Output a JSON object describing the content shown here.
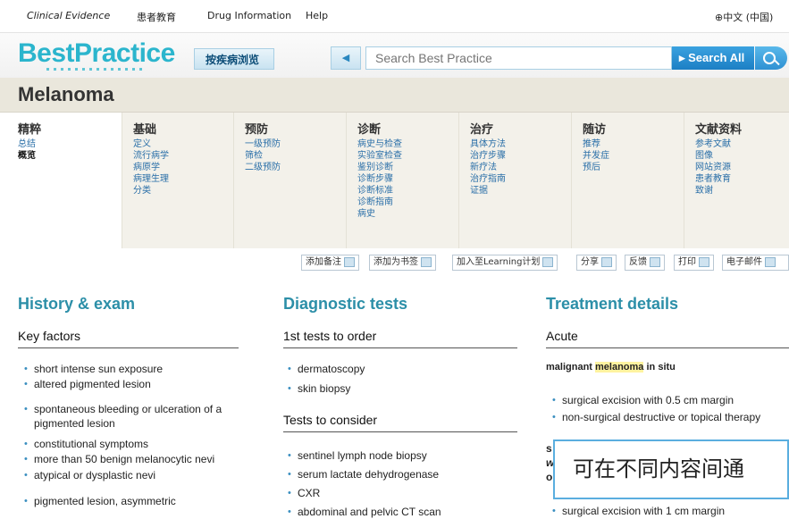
{
  "topnav": {
    "clinical_evidence": "Clinical Evidence",
    "patient_education": "患者教育",
    "drug_information": "Drug Information",
    "help": "Help",
    "language": "中文 (中国)"
  },
  "header": {
    "logo": "BestPractice",
    "browse_button": "按疾病浏览",
    "search_placeholder": "Search Best Practice",
    "search_all": "Search All"
  },
  "page": {
    "title": "Melanoma"
  },
  "nav": [
    {
      "head": "精粹",
      "items": [
        "总结",
        "概览"
      ],
      "active_index": 1
    },
    {
      "head": "基础",
      "items": [
        "定义",
        "流行病学",
        "病原学",
        "病理生理",
        "分类"
      ]
    },
    {
      "head": "预防",
      "items": [
        "一级预防",
        "筛检",
        "二级预防"
      ]
    },
    {
      "head": "诊断",
      "items": [
        "病史与检查",
        "实验室检查",
        "鉴别诊断",
        "诊断步骤",
        "诊断标准",
        "诊断指南",
        "病史"
      ]
    },
    {
      "head": "治疗",
      "items": [
        "具体方法",
        "治疗步骤",
        "新疗法",
        "治疗指南",
        "证据"
      ]
    },
    {
      "head": "随访",
      "items": [
        "推荐",
        "并发症",
        "预后"
      ]
    },
    {
      "head": "文献资料",
      "items": [
        "参考文献",
        "图像",
        "网站资源",
        "患者教育",
        "致谢"
      ]
    }
  ],
  "toolbar": {
    "add_note": "添加备注",
    "add_bookmark": "添加为书签",
    "add_learning": "加入至Learning计划",
    "share": "分享",
    "feedback": "反馈",
    "print": "打印",
    "email": "电子邮件"
  },
  "history": {
    "title": "History & exam",
    "subhead": "Key factors",
    "items": [
      "short intense sun exposure",
      "altered pigmented lesion",
      "spontaneous bleeding or ulceration of a pigmented lesion",
      "constitutional symptoms",
      "more than 50 benign melanocytic nevi",
      "atypical or dysplastic nevi",
      "pigmented lesion, asymmetric"
    ]
  },
  "diagnostic": {
    "title": "Diagnostic tests",
    "subhead1": "1st tests to order",
    "first": [
      "dermatoscopy",
      "skin biopsy"
    ],
    "subhead2": "Tests to consider",
    "consider": [
      "sentinel lymph node biopsy",
      "serum lactate dehydrogenase",
      "CXR",
      "abdominal and pelvic CT scan"
    ]
  },
  "treatment": {
    "title": "Treatment details",
    "subhead": "Acute",
    "case_prefix": "malignant ",
    "case_highlight": "melanoma",
    "case_suffix": " in situ",
    "items": [
      "surgical excision with 0.5 cm margin",
      "non-surgical destructive or topical therapy"
    ],
    "clip_s": "s",
    "clip_w": "w",
    "clip_o": "o",
    "last_item": "surgical excision with 1 cm margin"
  },
  "popup": {
    "text": "可在不同内容间通"
  }
}
